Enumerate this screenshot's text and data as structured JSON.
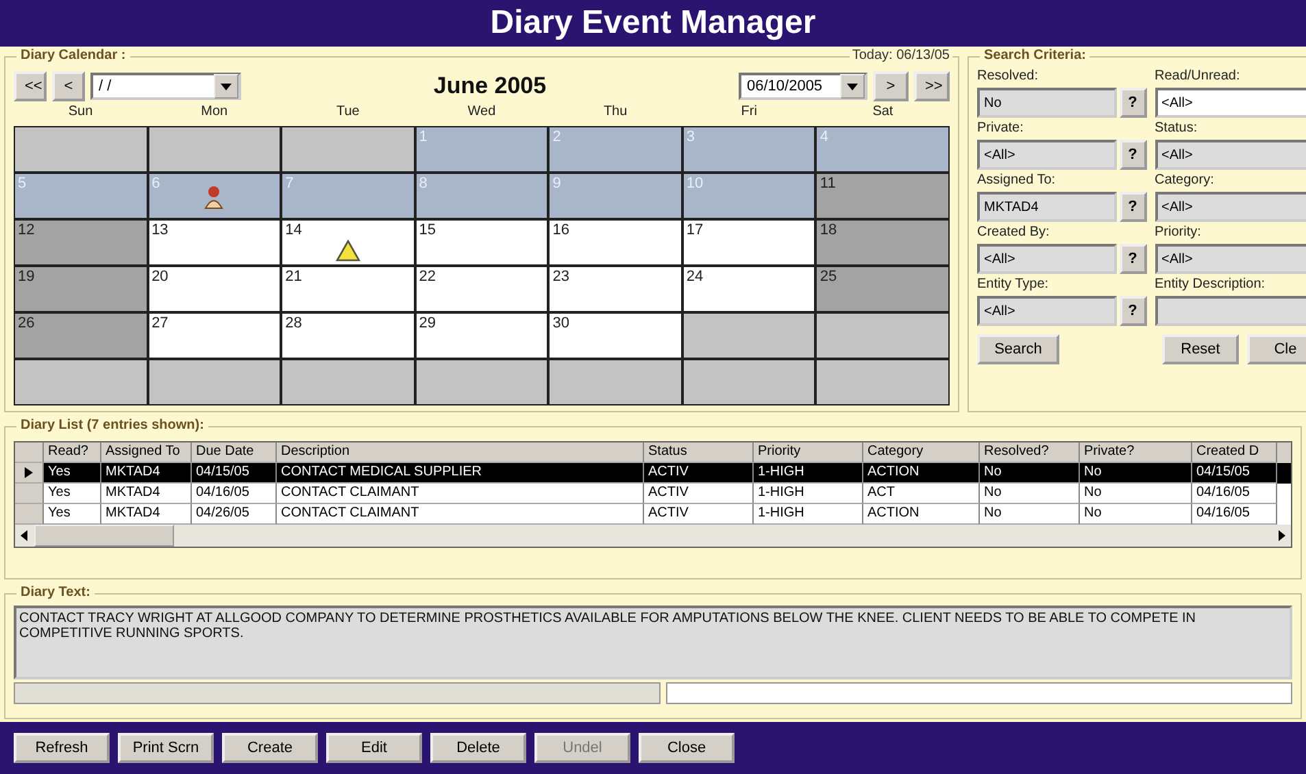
{
  "window": {
    "title": "Diary Event Manager"
  },
  "calendar": {
    "group_label": "Diary Calendar :",
    "today": "Today: 06/13/05",
    "prev_year": "<<",
    "prev_month": "<",
    "month_picker": "/ /",
    "month_title": "June 2005",
    "date_picker": "06/10/2005",
    "next_month": ">",
    "next_year": ">>",
    "weekdays": [
      "Sun",
      "Mon",
      "Tue",
      "Wed",
      "Thu",
      "Fri",
      "Sat"
    ],
    "weeks": [
      [
        {
          "kind": "outside"
        },
        {
          "kind": "outside"
        },
        {
          "kind": "outside"
        },
        {
          "kind": "past",
          "day": "1"
        },
        {
          "kind": "past",
          "day": "2"
        },
        {
          "kind": "past",
          "day": "3"
        },
        {
          "kind": "past",
          "day": "4"
        }
      ],
      [
        {
          "kind": "past",
          "day": "5"
        },
        {
          "kind": "past",
          "day": "6",
          "event": {
            "kind": "person"
          }
        },
        {
          "kind": "past",
          "day": "7"
        },
        {
          "kind": "past",
          "day": "8"
        },
        {
          "kind": "past",
          "day": "9"
        },
        {
          "kind": "past",
          "day": "10"
        },
        {
          "kind": "weekend",
          "day": "11"
        }
      ],
      [
        {
          "kind": "weekend",
          "day": "12"
        },
        {
          "kind": "day",
          "day": "13"
        },
        {
          "kind": "day",
          "day": "14",
          "event": {
            "kind": "warning"
          }
        },
        {
          "kind": "day",
          "day": "15"
        },
        {
          "kind": "day",
          "day": "16"
        },
        {
          "kind": "day",
          "day": "17"
        },
        {
          "kind": "weekend",
          "day": "18"
        }
      ],
      [
        {
          "kind": "weekend",
          "day": "19"
        },
        {
          "kind": "day",
          "day": "20"
        },
        {
          "kind": "day",
          "day": "21"
        },
        {
          "kind": "day",
          "day": "22"
        },
        {
          "kind": "day",
          "day": "23"
        },
        {
          "kind": "day",
          "day": "24"
        },
        {
          "kind": "weekend",
          "day": "25"
        }
      ],
      [
        {
          "kind": "weekend",
          "day": "26"
        },
        {
          "kind": "day",
          "day": "27"
        },
        {
          "kind": "day",
          "day": "28"
        },
        {
          "kind": "day",
          "day": "29"
        },
        {
          "kind": "day",
          "day": "30"
        },
        {
          "kind": "outside"
        },
        {
          "kind": "outside"
        }
      ],
      [
        {
          "kind": "outside"
        },
        {
          "kind": "outside"
        },
        {
          "kind": "outside"
        },
        {
          "kind": "outside"
        },
        {
          "kind": "outside"
        },
        {
          "kind": "outside"
        },
        {
          "kind": "outside"
        }
      ]
    ]
  },
  "search": {
    "group_label": "Search Criteria:",
    "fields": [
      {
        "label": "Resolved:",
        "value": "No",
        "lookup": "?",
        "white": false
      },
      {
        "label": "Read/Unread:",
        "value": "<All>",
        "white": true
      },
      {
        "label": "Private:",
        "value": "<All>",
        "lookup": "?",
        "white": false
      },
      {
        "label": "Status:",
        "value": "<All>",
        "white": false
      },
      {
        "label": "Assigned To:",
        "value": "MKTAD4",
        "lookup": "?",
        "white": false
      },
      {
        "label": "Category:",
        "value": "<All>",
        "white": false
      },
      {
        "label": "Created By:",
        "value": "<All>",
        "lookup": "?",
        "white": false
      },
      {
        "label": "Priority:",
        "value": "<All>",
        "white": false
      },
      {
        "label": "Entity Type:",
        "value": "<All>",
        "lookup": "?",
        "white": false
      },
      {
        "label": "Entity Description:",
        "white": false
      }
    ],
    "buttons": [
      "Search",
      "Reset",
      "Cle"
    ]
  },
  "diary_list": {
    "group_label": "Diary List (7 entries shown):",
    "columns": [
      "Read?",
      "Assigned To",
      "Due Date",
      "Description",
      "Status",
      "Priority",
      "Category",
      "Resolved?",
      "Private?",
      "Created D"
    ],
    "rows": [
      {
        "selected": true,
        "cells": [
          "Yes",
          "MKTAD4",
          "04/15/05",
          "CONTACT MEDICAL SUPPLIER",
          "ACTIV",
          "1-HIGH",
          "ACTION",
          "No",
          "No",
          "04/15/05"
        ]
      },
      {
        "selected": false,
        "cells": [
          "Yes",
          "MKTAD4",
          "04/16/05",
          "CONTACT CLAIMANT",
          "ACTIV",
          "1-HIGH",
          "ACT",
          "No",
          "No",
          "04/16/05"
        ]
      },
      {
        "selected": false,
        "cells": [
          "Yes",
          "MKTAD4",
          "04/26/05",
          "CONTACT CLAIMANT",
          "ACTIV",
          "1-HIGH",
          "ACTION",
          "No",
          "No",
          "04/16/05"
        ]
      }
    ]
  },
  "diary_text": {
    "group_label": "Diary Text:",
    "text": "CONTACT TRACY WRIGHT AT ALLGOOD COMPANY TO DETERMINE PROSTHETICS AVAILABLE FOR AMPUTATIONS BELOW THE KNEE.  CLIENT NEEDS TO BE ABLE TO COMPETE IN COMPETITIVE RUNNING SPORTS."
  },
  "buttons": [
    {
      "label": "Refresh",
      "disabled": false
    },
    {
      "label": "Print Scrn",
      "disabled": false
    },
    {
      "label": "Create",
      "disabled": false
    },
    {
      "label": "Edit",
      "disabled": false
    },
    {
      "label": "Delete",
      "disabled": false
    },
    {
      "label": "Undel",
      "disabled": true
    },
    {
      "label": "Close",
      "disabled": false
    }
  ]
}
